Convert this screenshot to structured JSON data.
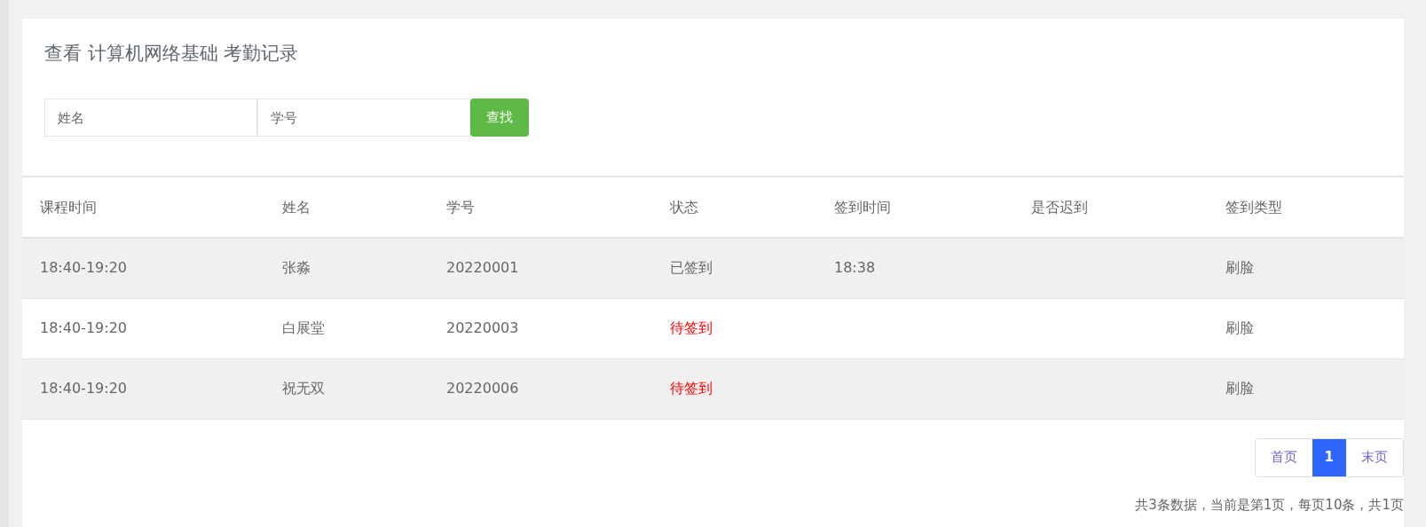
{
  "title": "查看 计算机网络基础 考勤记录",
  "search": {
    "fields": [
      {
        "placeholder": "姓名"
      },
      {
        "placeholder": "学号"
      }
    ],
    "button": "查找"
  },
  "table": {
    "columns": [
      "课程时间",
      "姓名",
      "学号",
      "状态",
      "签到时间",
      "是否迟到",
      "签到类型"
    ],
    "rows": [
      {
        "cells": [
          "18:40-19:20",
          "张淼",
          "20220001",
          "已签到",
          "18:38",
          "",
          "刷脸"
        ],
        "color": "#666666"
      },
      {
        "cells": [
          "18:40-19:20",
          "白展堂",
          "20220003",
          "待签到",
          "",
          "",
          "刷脸"
        ],
        "color": "#ff0000"
      },
      {
        "cells": [
          "18:40-19:20",
          "祝无双",
          "20220006",
          "待签到",
          "",
          "",
          "刷脸"
        ],
        "color": "#ff0000"
      }
    ]
  },
  "pagination": {
    "items": [
      {
        "label": "首页",
        "selected": false
      },
      {
        "label": "1",
        "selected": true
      },
      {
        "label": "末页",
        "selected": false
      }
    ],
    "summary": "共3条数据，当前是第1页，每页10条，共1页"
  }
}
